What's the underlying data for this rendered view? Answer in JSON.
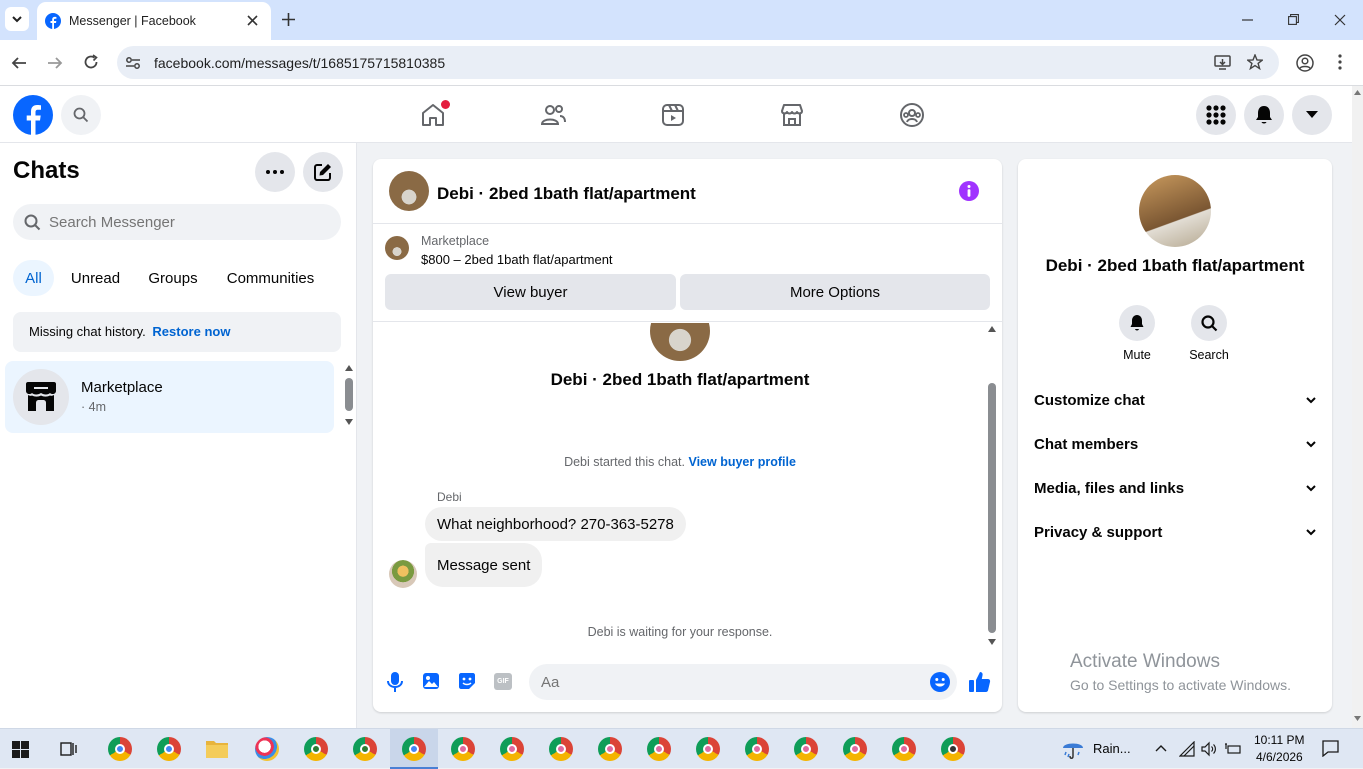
{
  "browser": {
    "tab_title": "Messenger | Facebook",
    "url": "facebook.com/messages/t/1685175715810385"
  },
  "sidebar": {
    "title": "Chats",
    "search_placeholder": "Search Messenger",
    "filters": [
      "All",
      "Unread",
      "Groups",
      "Communities"
    ],
    "missing_history": "Missing chat history.",
    "restore_link": "Restore now",
    "chats": [
      {
        "name": "Marketplace",
        "meta": "· 4m"
      }
    ]
  },
  "chat": {
    "header_title": "Debi · 2bed 1bath flat/apartment",
    "listing_source": "Marketplace",
    "listing_title": "$800 – 2bed 1bath flat/apartment",
    "view_buyer": "View buyer",
    "more_options": "More Options",
    "intro_name": "Debi · 2bed 1bath flat/apartment",
    "started_text": "Debi started this chat.",
    "buyer_profile_link": "View buyer profile",
    "sender_name": "Debi",
    "messages": [
      "What neighborhood? 270-363-5278",
      "Message sent"
    ],
    "waiting_text": "Debi is waiting for your response.",
    "composer_placeholder": "Aa"
  },
  "info": {
    "name": "Debi · 2bed 1bath flat/apartment",
    "actions": [
      "Mute",
      "Search"
    ],
    "sections": [
      "Customize chat",
      "Chat members",
      "Media, files and links",
      "Privacy & support"
    ]
  },
  "watermark": {
    "line1": "Activate Windows",
    "line2": "Go to Settings to activate Windows."
  },
  "taskbar": {
    "weather": "Rain...",
    "time": "10:11 PM",
    "date": "4/6/2026"
  },
  "colors": {
    "fb_blue": "#0866ff",
    "link_blue": "#0064d1",
    "purple": "#a033ff",
    "selected_chat": "#ebf5ff"
  }
}
